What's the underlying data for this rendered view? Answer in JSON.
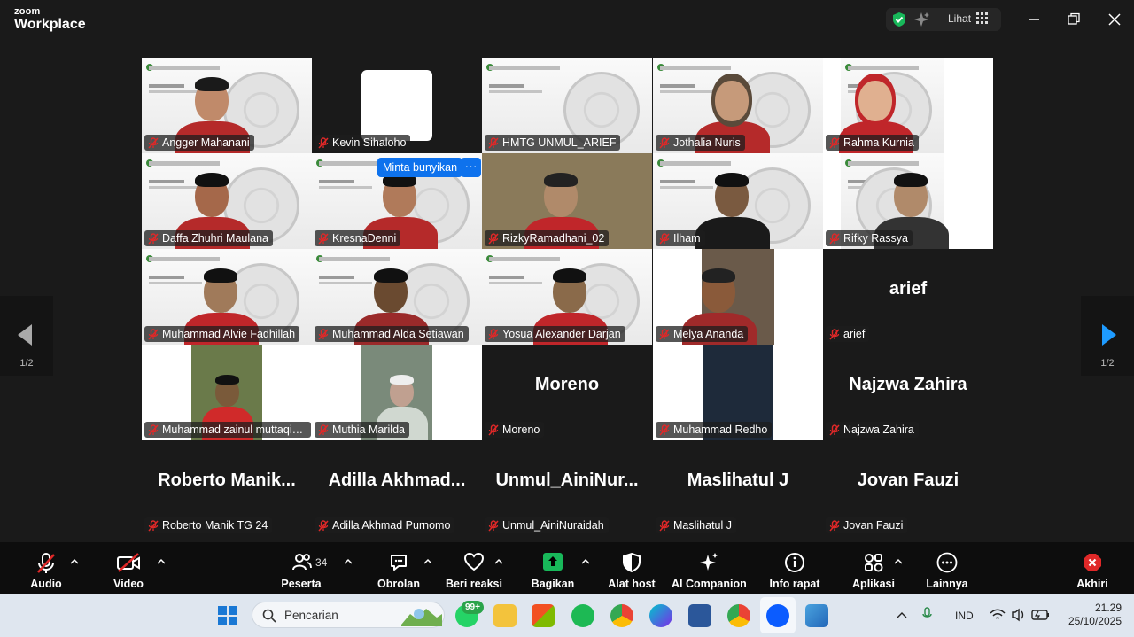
{
  "app": {
    "logo_top": "zoom",
    "logo_bottom": "Workplace",
    "view_label": "Lihat"
  },
  "gallery": {
    "page_indicator_left": "1/2",
    "page_indicator_right": "1/2",
    "unmute_request": "Minta bunyikan",
    "more_glyph": "···",
    "participants": [
      {
        "name": "Angger Mahanani",
        "muted": true
      },
      {
        "name": "Kevin Sihaloho",
        "muted": true
      },
      {
        "name": "HMTG UNMUL_ARIEF",
        "muted": true
      },
      {
        "name": "Jothalia Nuris",
        "muted": true
      },
      {
        "name": "Rahma Kurnia",
        "muted": true
      },
      {
        "name": "Daffa  Zhuhri Maulana",
        "muted": true
      },
      {
        "name": "KresnaDenni",
        "muted": true
      },
      {
        "name": "RizkyRamadhani_02",
        "muted": true
      },
      {
        "name": "Ilham",
        "muted": true
      },
      {
        "name": "Rifky Rassya",
        "muted": true
      },
      {
        "name": "Muhammad Alvie Fadhillah",
        "muted": true
      },
      {
        "name": "Muhammad Alda Setiawan",
        "muted": true
      },
      {
        "name": "Yosua Alexander Darjan",
        "muted": true
      },
      {
        "name": "Melya Ananda",
        "muted": true
      },
      {
        "name": "arief",
        "muted": true,
        "display": "arief"
      },
      {
        "name": "Muhammad zainul muttaqin...",
        "muted": true
      },
      {
        "name": "Muthia Marilda",
        "muted": true
      },
      {
        "name": "Moreno",
        "muted": true,
        "display": "Moreno"
      },
      {
        "name": "Muhammad Redho",
        "muted": true
      },
      {
        "name": "Najzwa Zahira",
        "muted": true,
        "display": "Najzwa Zahira"
      },
      {
        "name": "Roberto Manik TG 24",
        "muted": true,
        "display": "Roberto  Manik..."
      },
      {
        "name": "Adilla Akhmad Purnomo",
        "muted": true,
        "display": "Adilla  Akhmad..."
      },
      {
        "name": "Unmul_AiniNuraidah",
        "muted": true,
        "display": "Unmul_AiniNur..."
      },
      {
        "name": "Maslihatul J",
        "muted": true,
        "display": "Maslihatul J"
      },
      {
        "name": "Jovan Fauzi",
        "muted": true,
        "display": "Jovan Fauzi"
      }
    ]
  },
  "toolbar": {
    "audio": "Audio",
    "video": "Video",
    "participants": "Peserta",
    "participant_count": "34",
    "chat": "Obrolan",
    "react": "Beri reaksi",
    "share": "Bagikan",
    "host_tools": "Alat host",
    "ai_companion": "AI Companion",
    "meeting_info": "Info rapat",
    "apps": "Aplikasi",
    "more": "Lainnya",
    "end": "Akhiri"
  },
  "taskbar": {
    "search_placeholder": "Pencarian",
    "whatsapp_badge": "99+",
    "language": "IND",
    "time": "21.29",
    "date": "25/10/2025"
  },
  "colors": {
    "accent_blue": "#0e72ed",
    "active_speaker": "#2fd67b",
    "muted_red": "#e02828",
    "share_green": "#18b85a",
    "end_red": "#e02828"
  }
}
